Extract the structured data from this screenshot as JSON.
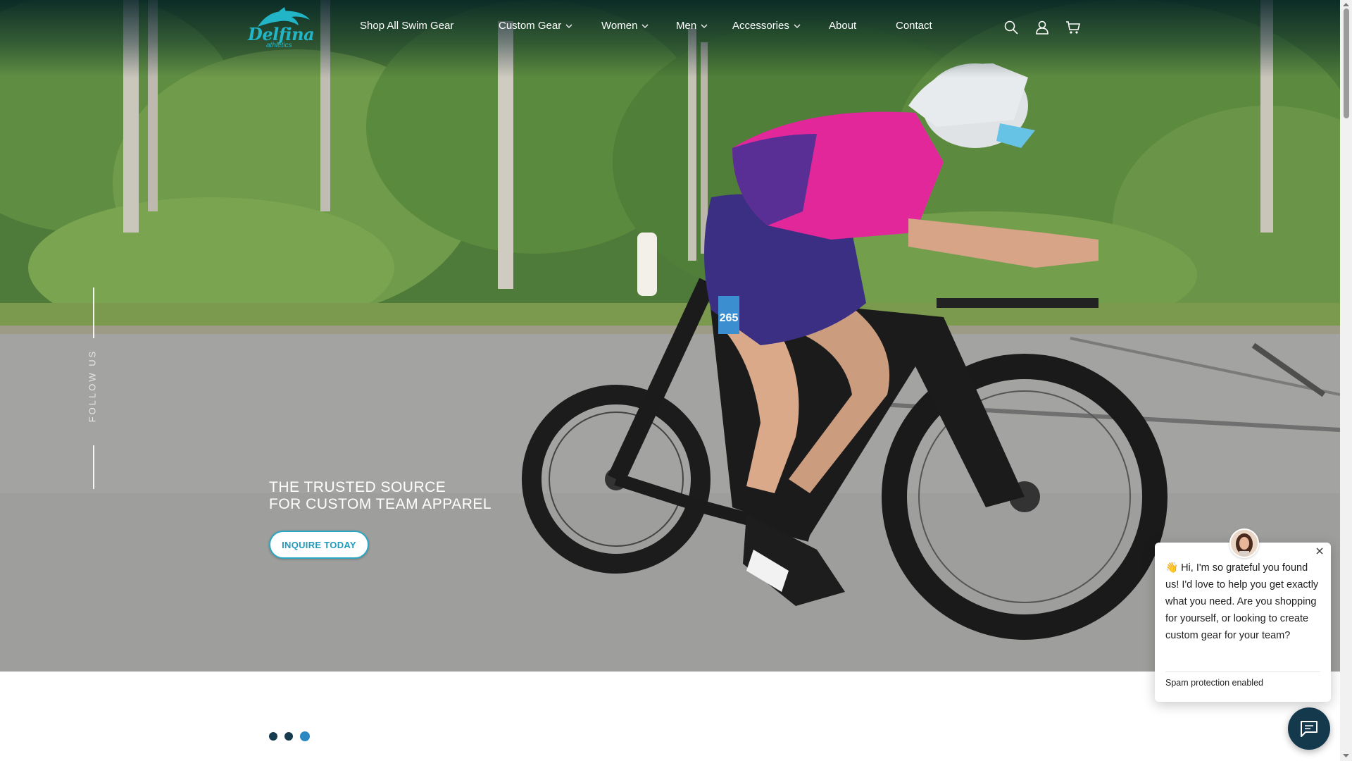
{
  "brand": {
    "name": "Delfina",
    "sub": "athletics"
  },
  "nav": {
    "items": [
      {
        "label": "Shop All Swim Gear",
        "dropdown": false
      },
      {
        "label": "Custom Gear",
        "dropdown": true
      },
      {
        "label": "Women",
        "dropdown": true
      },
      {
        "label": "Men",
        "dropdown": true
      },
      {
        "label": "Accessories",
        "dropdown": true
      },
      {
        "label": "About",
        "dropdown": false
      },
      {
        "label": "Contact",
        "dropdown": false
      }
    ],
    "icons": [
      "search-icon",
      "account-icon",
      "cart-icon"
    ]
  },
  "hero": {
    "follow_label": "FOLLOW US",
    "tagline_line1": "THE TRUSTED SOURCE",
    "tagline_line2": "FOR CUSTOM TEAM APPAREL",
    "cta_label": "INQUIRE TODAY",
    "bib_number": "265"
  },
  "carousel": {
    "slide_count": 3,
    "active_index": 2
  },
  "chat": {
    "message": "👋 Hi, I'm so grateful you found us! I'd love to help you get exactly what you need. Are you shopping for yourself, or looking to create custom gear for your team?",
    "spam_note": "Spam protection enabled"
  },
  "colors": {
    "accent": "#2aa7c4",
    "chat_button": "#14394d",
    "dot_active": "#2a87c2",
    "dot": "#163b4e"
  }
}
